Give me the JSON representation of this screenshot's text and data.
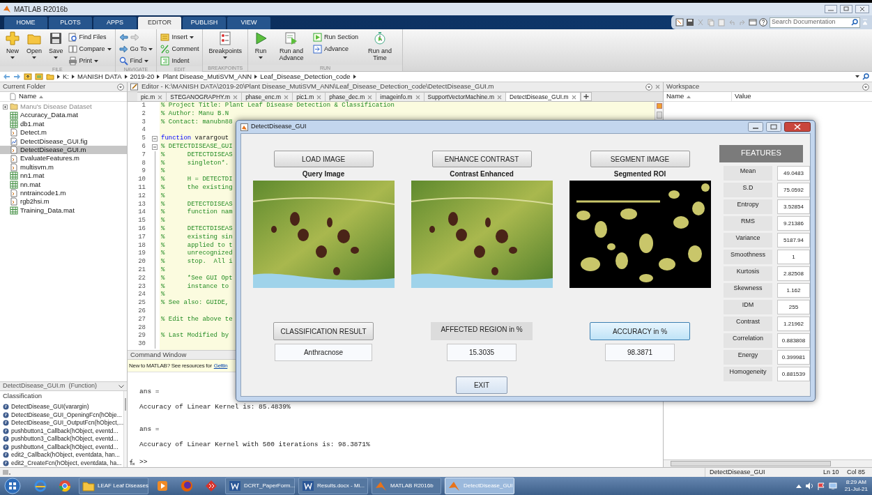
{
  "app_title": "MATLAB R2016b",
  "ribbon_tabs": [
    {
      "label": "HOME",
      "selected": false
    },
    {
      "label": "PLOTS",
      "selected": false
    },
    {
      "label": "APPS",
      "selected": false
    },
    {
      "label": "EDITOR",
      "selected": true
    },
    {
      "label": "PUBLISH",
      "selected": false
    },
    {
      "label": "VIEW",
      "selected": false
    }
  ],
  "search": {
    "placeholder": "Search Documentation"
  },
  "toolstrip": [
    {
      "label": "FILE",
      "items": [
        {
          "kind": "large",
          "label": "New",
          "dropdown": true
        },
        {
          "kind": "large",
          "label": "Open",
          "dropdown": true
        },
        {
          "kind": "large",
          "label": "Save",
          "dropdown": true
        },
        {
          "kind": "stack",
          "entries": [
            {
              "label": "Find Files",
              "dropdown": false
            },
            {
              "label": "Compare",
              "dropdown": true
            },
            {
              "label": "Print",
              "dropdown": true
            }
          ]
        }
      ]
    },
    {
      "label": "NAVIGATE",
      "items": [
        {
          "kind": "stack",
          "entries": [
            {
              "kind": "arrows"
            },
            {
              "label": "Go To",
              "dropdown": true
            },
            {
              "label": "Find",
              "dropdown": true
            }
          ]
        }
      ]
    },
    {
      "label": "EDIT",
      "items": [
        {
          "kind": "stack",
          "entries": [
            {
              "label": "Insert",
              "dropdown": true
            },
            {
              "label": "Comment",
              "dropdown": false
            },
            {
              "label": "Indent",
              "dropdown": false
            }
          ]
        }
      ]
    },
    {
      "label": "BREAKPOINTS",
      "items": [
        {
          "kind": "large",
          "label": "Breakpoints",
          "dropdown": true
        }
      ]
    },
    {
      "label": "RUN",
      "items": [
        {
          "kind": "large",
          "label": "Run",
          "dropdown": true
        },
        {
          "kind": "large",
          "label": "Run and Advance",
          "dropdown": false
        },
        {
          "kind": "stack",
          "entries": [
            {
              "label": "Run Section",
              "dropdown": false
            },
            {
              "label": "Advance",
              "dropdown": false
            }
          ]
        },
        {
          "kind": "large",
          "label": "Run and Time",
          "dropdown": false
        }
      ]
    }
  ],
  "address_path": [
    "K:",
    "MANISH DATA",
    "2019-20",
    "Plant Disease_MutiSVM_ANN",
    "Leaf_Disease_Detection_code"
  ],
  "current_folder": {
    "title": "Current Folder",
    "column": "Name",
    "items": [
      {
        "name": "Manu's Disease Dataset",
        "kind": "folder",
        "selected": false,
        "dimmed": true
      },
      {
        "name": "Accuracy_Data.mat",
        "kind": "mat",
        "selected": false,
        "dimmed": false
      },
      {
        "name": "db1.mat",
        "kind": "mat",
        "selected": false,
        "dimmed": false
      },
      {
        "name": "Detect.m",
        "kind": "m",
        "selected": false,
        "dimmed": false
      },
      {
        "name": "DetectDisease_GUI.fig",
        "kind": "fig",
        "selected": false,
        "dimmed": false
      },
      {
        "name": "DetectDisease_GUI.m",
        "kind": "m",
        "selected": true,
        "dimmed": false
      },
      {
        "name": "EvaluateFeatures.m",
        "kind": "m",
        "selected": false,
        "dimmed": false
      },
      {
        "name": "multisvm.m",
        "kind": "m",
        "selected": false,
        "dimmed": false
      },
      {
        "name": "nn1.mat",
        "kind": "mat",
        "selected": false,
        "dimmed": false
      },
      {
        "name": "nn.mat",
        "kind": "mat",
        "selected": false,
        "dimmed": false
      },
      {
        "name": "nntraincode1.m",
        "kind": "m",
        "selected": false,
        "dimmed": false
      },
      {
        "name": "rgb2hsi.m",
        "kind": "m",
        "selected": false,
        "dimmed": false
      },
      {
        "name": "Training_Data.mat",
        "kind": "mat",
        "selected": false,
        "dimmed": false
      }
    ]
  },
  "details": {
    "title": "DetectDisease_GUI.m  (Function)",
    "heading": "Classification",
    "functions": [
      "DetectDisease_GUI(varargin)",
      "DetectDisease_GUI_OpeningFcn(hObje...",
      "DetectDisease_GUI_OutputFcn(hObject,...",
      "pushbutton1_Callback(hObject, eventd...",
      "pushbutton3_Callback(hObject, eventd...",
      "pushbutton4_Callback(hObject, eventd...",
      "edit2_Callback(hObject, eventdata, han...",
      "edit2_CreateFcn(hObject, eventdata, ha..."
    ]
  },
  "editor": {
    "title": "Editor - K:\\MANISH DATA\\2019-20\\Plant Disease_MutiSVM_ANN\\Leaf_Disease_Detection_code\\DetectDisease_GUI.m",
    "tabs": [
      {
        "label": "pic.m",
        "selected": false
      },
      {
        "label": "STEGANOGRAPHY.m",
        "selected": false
      },
      {
        "label": "phase_enc.m",
        "selected": false
      },
      {
        "label": "pic1.m",
        "selected": false
      },
      {
        "label": "phase_dec.m",
        "selected": false
      },
      {
        "label": "imageinfo.m",
        "selected": false
      },
      {
        "label": "SupportVectorMachine.m",
        "selected": false
      },
      {
        "label": "DetectDisease_GUI.m",
        "selected": true
      }
    ],
    "lines": [
      {
        "number": "1",
        "kind": "comment",
        "text": "% Project Title: Plant Leaf Disease Detection & Classification",
        "fold": false
      },
      {
        "number": "2",
        "kind": "comment",
        "text": "% Author: Manu B.N",
        "fold": false
      },
      {
        "number": "3",
        "kind": "comment",
        "text": "% Contact: manubn88",
        "fold": false
      },
      {
        "number": "4",
        "kind": "blank",
        "fold": false
      },
      {
        "number": "5",
        "kind": "code",
        "keyword": "function",
        "text": " varargout",
        "fold": true
      },
      {
        "number": "6",
        "kind": "comment",
        "text": "% DETECTDISEASE_GUI",
        "fold": true
      },
      {
        "number": "7",
        "kind": "comment",
        "text": "%      DETECTDISEAS",
        "fold": false
      },
      {
        "number": "8",
        "kind": "comment",
        "text": "%      singleton*.",
        "fold": false
      },
      {
        "number": "9",
        "kind": "comment",
        "text": "%",
        "fold": false
      },
      {
        "number": "10",
        "kind": "comment",
        "text": "%      H = DETECTDI",
        "fold": false
      },
      {
        "number": "11",
        "kind": "comment",
        "text": "%      the existing",
        "fold": false
      },
      {
        "number": "12",
        "kind": "comment",
        "text": "%",
        "fold": false
      },
      {
        "number": "13",
        "kind": "comment",
        "text": "%      DETECTDISEAS",
        "fold": false
      },
      {
        "number": "14",
        "kind": "comment",
        "text": "%      function nam",
        "fold": false
      },
      {
        "number": "15",
        "kind": "comment",
        "text": "%",
        "fold": false
      },
      {
        "number": "16",
        "kind": "comment",
        "text": "%      DETECTDISEAS",
        "fold": false
      },
      {
        "number": "17",
        "kind": "comment",
        "text": "%      existing sin",
        "fold": false
      },
      {
        "number": "18",
        "kind": "comment",
        "text": "%      applied to t",
        "fold": false
      },
      {
        "number": "19",
        "kind": "comment",
        "text": "%      unrecognized",
        "fold": false
      },
      {
        "number": "20",
        "kind": "comment",
        "text": "%      stop.  All i",
        "fold": false
      },
      {
        "number": "21",
        "kind": "comment",
        "text": "%",
        "fold": false
      },
      {
        "number": "22",
        "kind": "comment",
        "text": "%      *See GUI Opt",
        "fold": false
      },
      {
        "number": "23",
        "kind": "comment",
        "text": "%      instance to",
        "fold": false
      },
      {
        "number": "24",
        "kind": "comment",
        "text": "%",
        "fold": false
      },
      {
        "number": "25",
        "kind": "comment",
        "text": "% See also: GUIDE,",
        "fold": false
      },
      {
        "number": "26",
        "kind": "blank",
        "fold": false
      },
      {
        "number": "27",
        "kind": "comment",
        "text": "% Edit the above te",
        "fold": false
      },
      {
        "number": "28",
        "kind": "blank",
        "fold": false
      },
      {
        "number": "29",
        "kind": "comment",
        "text": "% Last Modified by",
        "fold": false
      },
      {
        "number": "30",
        "kind": "blank",
        "fold": false
      }
    ]
  },
  "command_window": {
    "title": "Command Window",
    "notice": "New to MATLAB? See resources for",
    "link": "Gettin",
    "output": [
      {
        "label": "ans =",
        "result": "Accuracy of Linear Kernel is: 85.4839%"
      },
      {
        "label": "ans =",
        "result": "Accuracy of Linear Kernel with 500 iterations is: 98.3871%"
      }
    ],
    "prompt": ">>"
  },
  "workspace": {
    "title": "Workspace",
    "columns": [
      "Name",
      "Value"
    ]
  },
  "status_bar": {
    "file": "DetectDisease_GUI",
    "line": "Ln 10",
    "col": "Col 85"
  },
  "gui": {
    "title": "DetectDisease_GUI",
    "columns": [
      {
        "button": "LOAD IMAGE",
        "caption": "Query Image",
        "kind": "photo"
      },
      {
        "button": "ENHANCE CONTRAST",
        "caption": "Contrast Enhanced",
        "kind": "photo"
      },
      {
        "button": "SEGMENT IMAGE",
        "caption": "Segmented ROI",
        "kind": "mask"
      }
    ],
    "results": [
      {
        "kind": "button",
        "label": "CLASSIFICATION RESULT",
        "focused": false,
        "value": "Anthracnose"
      },
      {
        "kind": "label",
        "label": "AFFECTED REGION in %",
        "value": "15.3035"
      },
      {
        "kind": "button",
        "label": "ACCURACY in %",
        "focused": true,
        "value": "98.3871"
      }
    ],
    "exit": "EXIT",
    "features_title": "FEATURES",
    "features": [
      {
        "label": "Mean",
        "value": "49.0483"
      },
      {
        "label": "S.D",
        "value": "75.0592"
      },
      {
        "label": "Entropy",
        "value": "3.52854"
      },
      {
        "label": "RMS",
        "value": "9.21386"
      },
      {
        "label": "Variance",
        "value": "5187.94"
      },
      {
        "label": "Smoothness",
        "value": "1"
      },
      {
        "label": "Kurtosis",
        "value": "2.82508"
      },
      {
        "label": "Skewness",
        "value": "1.162"
      },
      {
        "label": "IDM",
        "value": "255"
      },
      {
        "label": "Contrast",
        "value": "1.21962"
      },
      {
        "label": "Correlation",
        "value": "0.883808"
      },
      {
        "label": "Energy",
        "value": "0.399981"
      },
      {
        "label": "Homogeneity",
        "value": "0.881539"
      }
    ]
  },
  "taskbar": {
    "items": [
      {
        "kind": "start"
      },
      {
        "kind": "pinned"
      },
      {
        "kind": "pinned"
      },
      {
        "kind": "window",
        "label": "LEAF Leaf Diseases",
        "active": false
      },
      {
        "kind": "pinned"
      },
      {
        "kind": "pinned"
      },
      {
        "kind": "pinned"
      },
      {
        "kind": "window",
        "label": "DCRT_PaperForm...",
        "active": false
      },
      {
        "kind": "window",
        "label": "Results.docx - Mi...",
        "active": false
      },
      {
        "kind": "window",
        "label": "MATLAB R2016b",
        "active": false
      },
      {
        "kind": "window",
        "label": "DetectDisease_GUI",
        "active": true
      }
    ],
    "time": "8:29 AM",
    "date": "21-Jul-21"
  }
}
